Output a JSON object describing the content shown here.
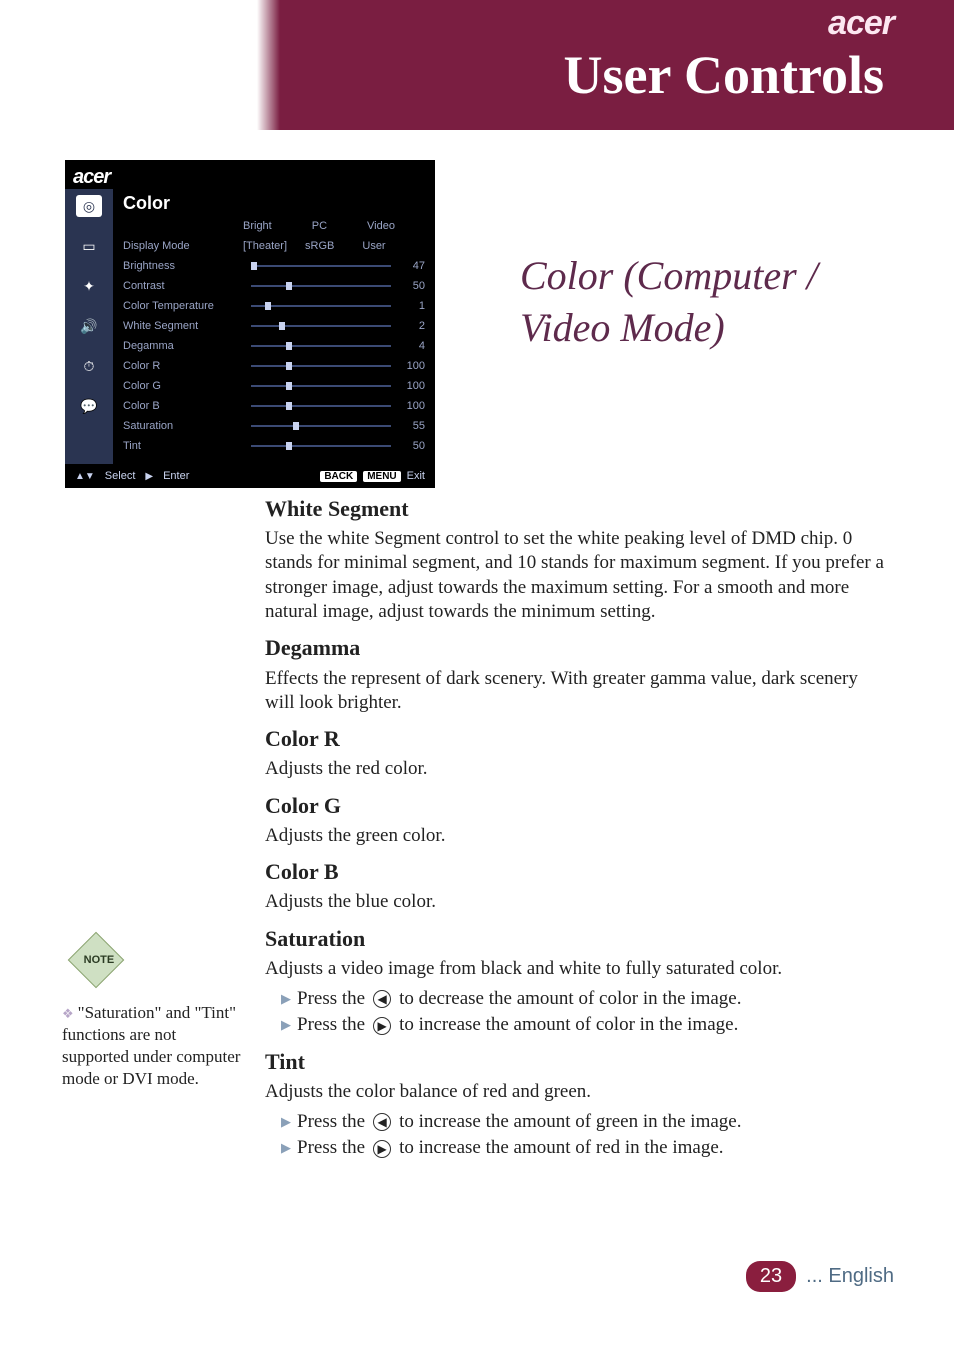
{
  "header": {
    "brand": "acer",
    "title": "User Controls"
  },
  "section_title": "Color (Computer / Video Mode)",
  "osd": {
    "brand": "acer",
    "heading": "Color",
    "mode_cols": [
      "Bright",
      "PC",
      "Video"
    ],
    "display_mode_row": {
      "label": "Display Mode",
      "options": [
        "[Theater]",
        "sRGB",
        "User"
      ]
    },
    "rows": [
      {
        "label": "Brightness",
        "value": "47",
        "pos": "p0"
      },
      {
        "label": "Contrast",
        "value": "50",
        "pos": "p25"
      },
      {
        "label": "Color Temperature",
        "value": "1",
        "pos": "p10"
      },
      {
        "label": "White Segment",
        "value": "2",
        "pos": "p20"
      },
      {
        "label": "Degamma",
        "value": "4",
        "pos": "p25"
      },
      {
        "label": "Color R",
        "value": "100",
        "pos": "p25"
      },
      {
        "label": "Color G",
        "value": "100",
        "pos": "p25"
      },
      {
        "label": "Color B",
        "value": "100",
        "pos": "p25"
      },
      {
        "label": "Saturation",
        "value": "55",
        "pos": "p30"
      },
      {
        "label": "Tint",
        "value": "50",
        "pos": "p25"
      }
    ],
    "footer": {
      "select": "Select",
      "enter": "Enter",
      "back": "BACK",
      "menu": "MENU",
      "exit": "Exit"
    }
  },
  "body": {
    "white_segment": {
      "h": "White Segment",
      "p": "Use the white Segment control to set the white peaking level of DMD chip. 0 stands for minimal segment, and 10 stands for maximum segment. If you prefer a stronger image, adjust towards the maximum setting. For a smooth and more natural image, adjust towards the minimum setting."
    },
    "degamma": {
      "h": "Degamma",
      "p": "Effects the represent of dark scenery. With greater gamma value, dark scenery will look brighter."
    },
    "color_r": {
      "h": "Color R",
      "p": "Adjusts the red color."
    },
    "color_g": {
      "h": "Color G",
      "p": "Adjusts the green color."
    },
    "color_b": {
      "h": "Color B",
      "p": "Adjusts the blue color."
    },
    "saturation": {
      "h": "Saturation",
      "p": "Adjusts a video image from black and white to fully saturated color.",
      "b1a": "Press the",
      "b1b": "to decrease the amount of color in the image.",
      "b2a": "Press the",
      "b2b": "to increase the amount of color in the image."
    },
    "tint": {
      "h": "Tint",
      "p": "Adjusts the color balance of red and green.",
      "b1a": "Press the",
      "b1b": "to increase the amount of green in the image.",
      "b2a": "Press the",
      "b2b": "to increase the amount of red in the image."
    }
  },
  "note": {
    "flag": "NOTE",
    "text": "\"Saturation\" and \"Tint\" functions are not supported under computer mode or DVI mode."
  },
  "footer": {
    "page": "23",
    "lang": "... English"
  }
}
